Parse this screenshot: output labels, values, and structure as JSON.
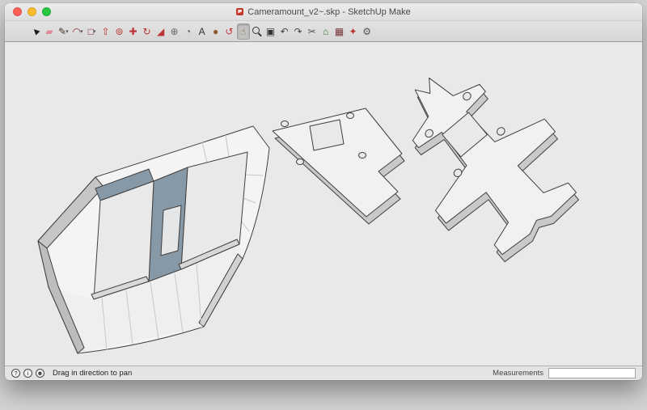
{
  "window": {
    "title": "Cameramount_v2~.skp - SketchUp Make",
    "traffic_lights": {
      "close": "#ff5f57",
      "minimize": "#febc2e",
      "zoom": "#28c840"
    }
  },
  "toolbar": {
    "tools": [
      {
        "name": "select",
        "glyph": "►",
        "color": "#1c1c1c"
      },
      {
        "name": "eraser",
        "glyph": "▰",
        "color": "#d98a9a"
      },
      {
        "name": "line",
        "glyph": "✎",
        "color": "#4a352a",
        "dropdown": "▾"
      },
      {
        "name": "arc",
        "glyph": "◠",
        "color": "#8a2f2f",
        "dropdown": "▾"
      },
      {
        "name": "shapes",
        "glyph": "□",
        "color": "#8a2f2f",
        "dropdown": "▾"
      },
      {
        "name": "push-pull",
        "glyph": "⇧",
        "color": "#bb3333"
      },
      {
        "name": "offset",
        "glyph": "⊚",
        "color": "#bb3333"
      },
      {
        "name": "move",
        "glyph": "✚",
        "color": "#bb3333"
      },
      {
        "name": "rotate",
        "glyph": "↻",
        "color": "#bb3333"
      },
      {
        "name": "scale",
        "glyph": "◢",
        "color": "#bb3333"
      },
      {
        "name": "tape-measure",
        "glyph": "⊕",
        "color": "#666666"
      },
      {
        "name": "protractor",
        "glyph": "◔",
        "color": "#666666"
      },
      {
        "name": "text",
        "glyph": "A",
        "color": "#333333"
      },
      {
        "name": "paint-bucket",
        "glyph": "●",
        "color": "#8a5a2a"
      },
      {
        "name": "orbit",
        "glyph": "↺",
        "color": "#c23535"
      },
      {
        "name": "pan",
        "glyph": "☝",
        "color": "#8a6a42",
        "selected": true
      },
      {
        "name": "zoom",
        "glyph": "",
        "color": "#333333"
      },
      {
        "name": "zoom-extents",
        "glyph": "▣",
        "color": "#333333"
      },
      {
        "name": "previous-view",
        "glyph": "↶",
        "color": "#444444"
      },
      {
        "name": "next-view",
        "glyph": "↷",
        "color": "#444444"
      },
      {
        "name": "section-plane",
        "glyph": "✂",
        "color": "#555555"
      },
      {
        "name": "get-models",
        "glyph": "⌂",
        "color": "#2f7a2f"
      },
      {
        "name": "components",
        "glyph": "▦",
        "color": "#7a3a3a"
      },
      {
        "name": "styles",
        "glyph": "✦",
        "color": "#bb3333"
      },
      {
        "name": "preferences",
        "glyph": "⚙",
        "color": "#555555"
      }
    ]
  },
  "canvas": {
    "colors": {
      "background": "#e9e9e9",
      "model_top": "#f1f1f1",
      "model_side": "#c9c9c9",
      "selected_face": "#8798a6",
      "edge": "#3f3f3f"
    },
    "models": [
      "camera-mount-body",
      "mount-plate",
      "jet-shaped-plate"
    ]
  },
  "statusbar": {
    "icons": [
      {
        "name": "help",
        "glyph": "?"
      },
      {
        "name": "instructor",
        "glyph": "i"
      },
      {
        "name": "user",
        "glyph": "☻"
      }
    ],
    "hint": "Drag in direction to pan",
    "measurements_label": "Measurements",
    "measurements_value": ""
  }
}
